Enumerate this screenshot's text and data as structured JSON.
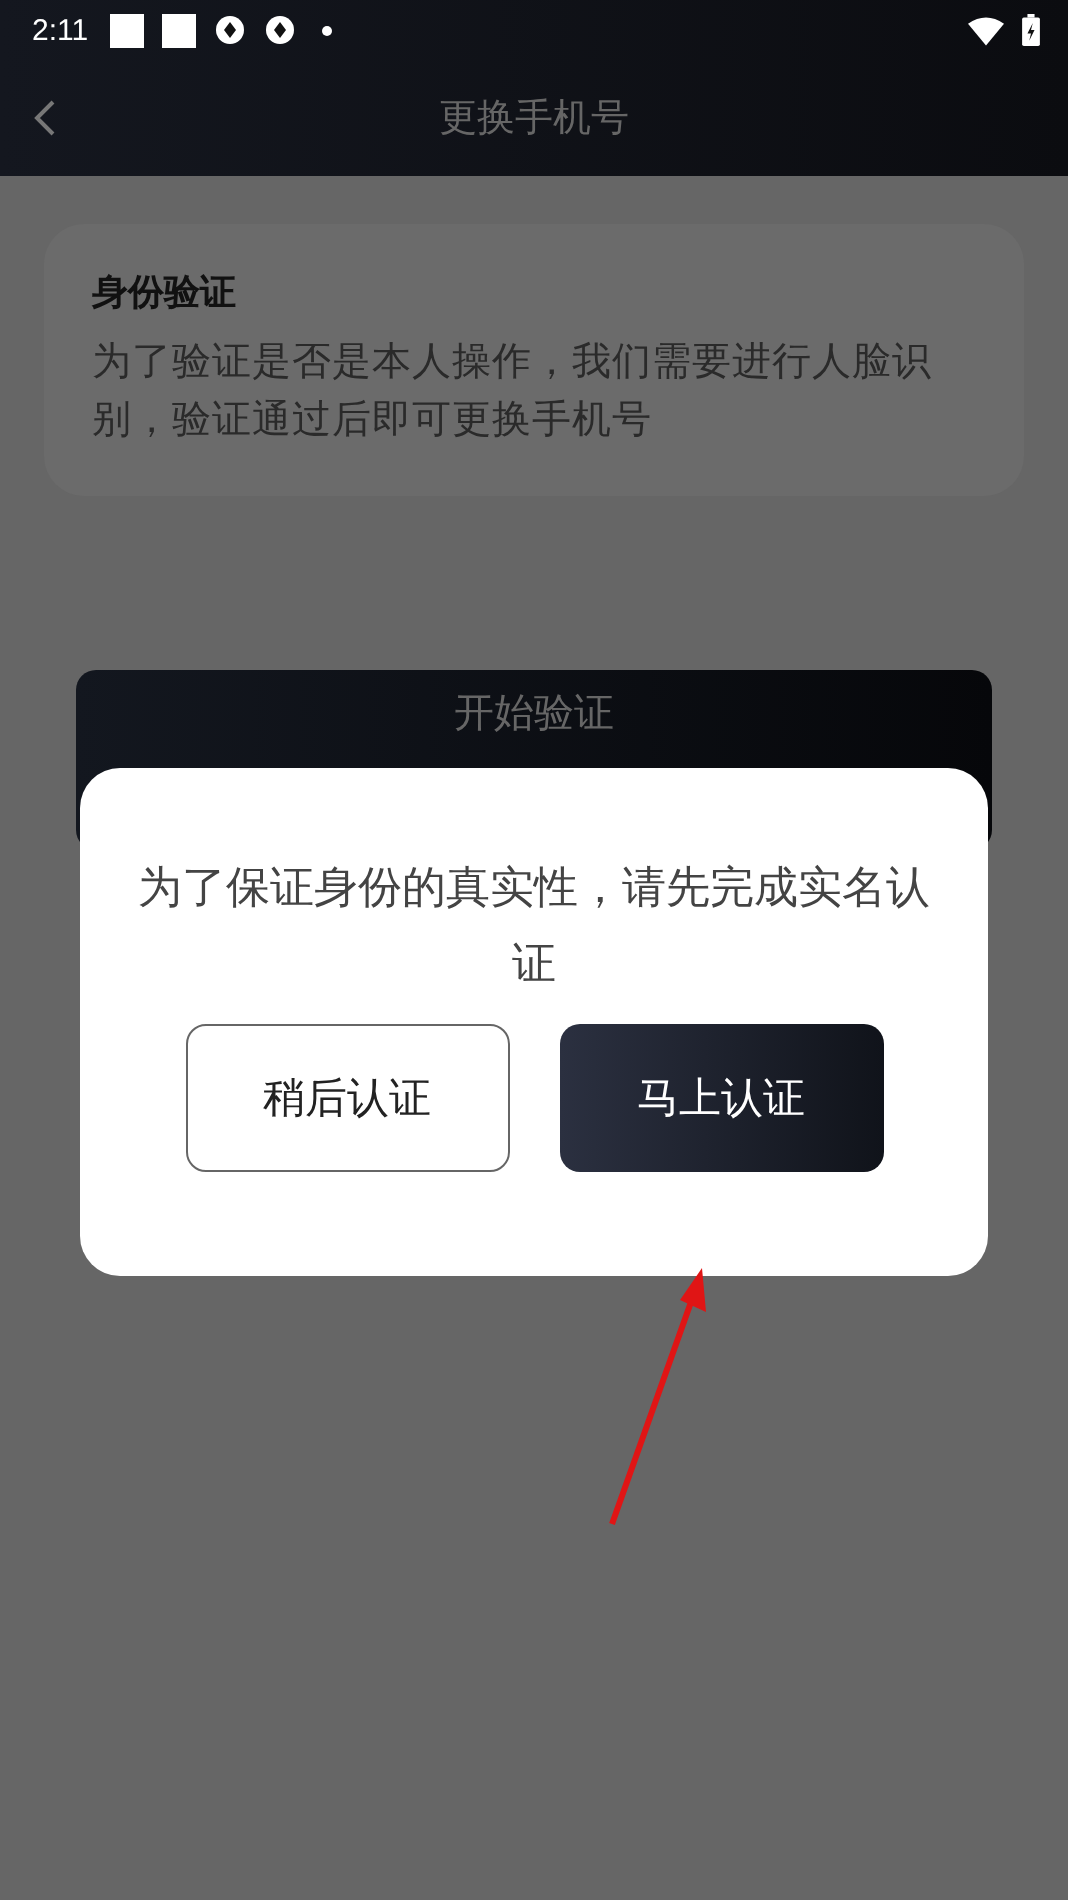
{
  "status_bar": {
    "time": "2:11"
  },
  "nav_bar": {
    "title": "更换手机号"
  },
  "verify_card": {
    "title": "身份验证",
    "description": "为了验证是否是本人操作，我们需要进行人脸识别，验证通过后即可更换手机号"
  },
  "start_button": {
    "label": "开始验证"
  },
  "dialog": {
    "message": "为了保证身份的真实性，请先完成实名认证",
    "buttons": [
      {
        "label": "稍后认证",
        "kind": "secondary"
      },
      {
        "label": "马上认证",
        "kind": "primary"
      }
    ]
  }
}
